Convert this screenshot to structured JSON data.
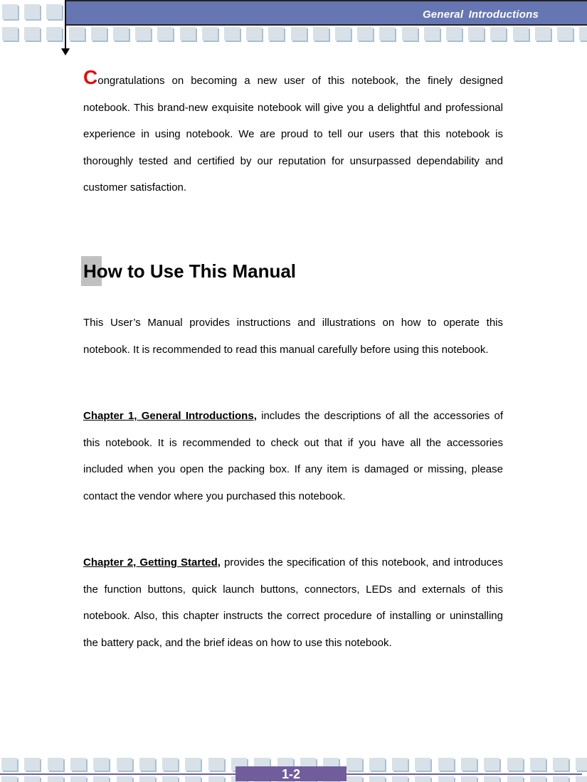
{
  "header": {
    "section_title": "General  Introductions"
  },
  "intro": {
    "dropcap": "C",
    "text": "ongratulations on becoming a new user of this notebook, the finely designed notebook.   This brand-new exquisite notebook will give you a delightful and professional experience in using notebook.    We are proud to tell our users that this notebook is thoroughly tested and certified by our reputation for unsurpassed dependability and customer satisfaction."
  },
  "section": {
    "heading": "How to Use This Manual",
    "paragraph": "This User’s Manual provides instructions and illustrations on how to operate this notebook.   It is recommended to read this manual carefully before using this notebook."
  },
  "chapters": [
    {
      "link": "Chapter 1, General Introductions",
      "punct": ",",
      "text": " includes the descriptions of all the accessories of this notebook.    It is recommended to check out that if you have all the accessories included when you open the packing box.   If any item is damaged or missing, please contact the vendor where you purchased this notebook."
    },
    {
      "link": "Chapter 2, Getting Started",
      "punct": ",",
      "text": " provides the specification of this notebook, and introduces the function buttons, quick launch buttons, connectors, LEDs and externals of this notebook.    Also, this chapter instructs the correct procedure of installing or uninstalling the battery pack, and the brief ideas on how to use this notebook."
    }
  ],
  "footer": {
    "page_number": "1-2"
  },
  "colors": {
    "banner": "#6676b2",
    "dropcap": "#e01010",
    "page_tab": "#715c9c",
    "tile": "#d8e0e8"
  }
}
